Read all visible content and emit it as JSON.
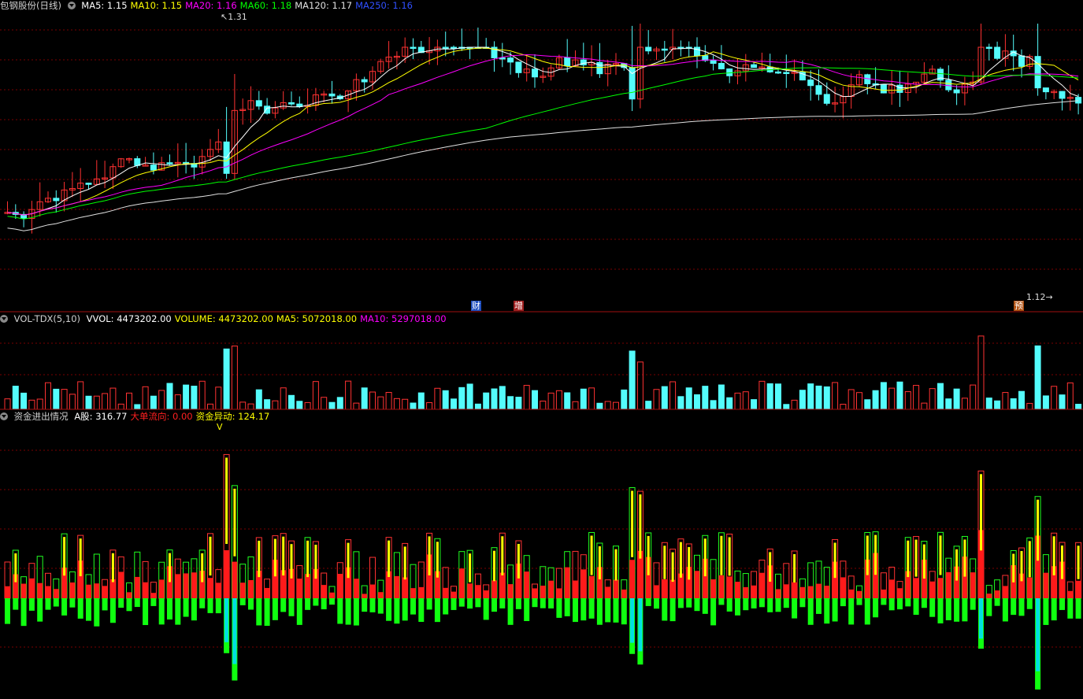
{
  "main": {
    "stock_name": "包钢股份(日线)",
    "ma_labels": [
      {
        "text": "MA5: 1.15",
        "color": "#ffffff"
      },
      {
        "text": "MA10: 1.15",
        "color": "#ffff00"
      },
      {
        "text": "MA20: 1.16",
        "color": "#ff00ff"
      },
      {
        "text": "MA60: 1.18",
        "color": "#00ff00"
      },
      {
        "text": "MA120: 1.17",
        "color": "#e0e0e0"
      },
      {
        "text": "MA250: 1.16",
        "color": "#3050ff"
      }
    ],
    "high_label": "1.31",
    "low_label": "1.12",
    "badges": [
      {
        "text": "财",
        "color": "#2050c0"
      },
      {
        "text": "增",
        "color": "#a02020"
      },
      {
        "text": "预",
        "color": "#b05010"
      }
    ]
  },
  "volume": {
    "indicator": "VOL-TDX(5,10)",
    "items": [
      {
        "text": "VVOL: 4473202.00",
        "color": "#ffffff"
      },
      {
        "text": "VOLUME: 4473202.00",
        "color": "#ffff00"
      },
      {
        "text": "MA5: 5072018.00",
        "color": "#ffff00"
      },
      {
        "text": "MA10: 5297018.00",
        "color": "#ff00ff"
      }
    ]
  },
  "fund": {
    "indicator": "资金进出情况",
    "items": [
      {
        "text": "A股: 316.77",
        "color": "#ffffff"
      },
      {
        "text": "大单流向: 0.00",
        "color": "#ff2020"
      },
      {
        "text": "资金异动: 124.17",
        "color": "#ffff00"
      }
    ],
    "marker": "V"
  },
  "colors": {
    "up": "#ff3232",
    "down": "#54fcfc",
    "grid": "#7a0000",
    "flat": "#ffffff"
  }
}
